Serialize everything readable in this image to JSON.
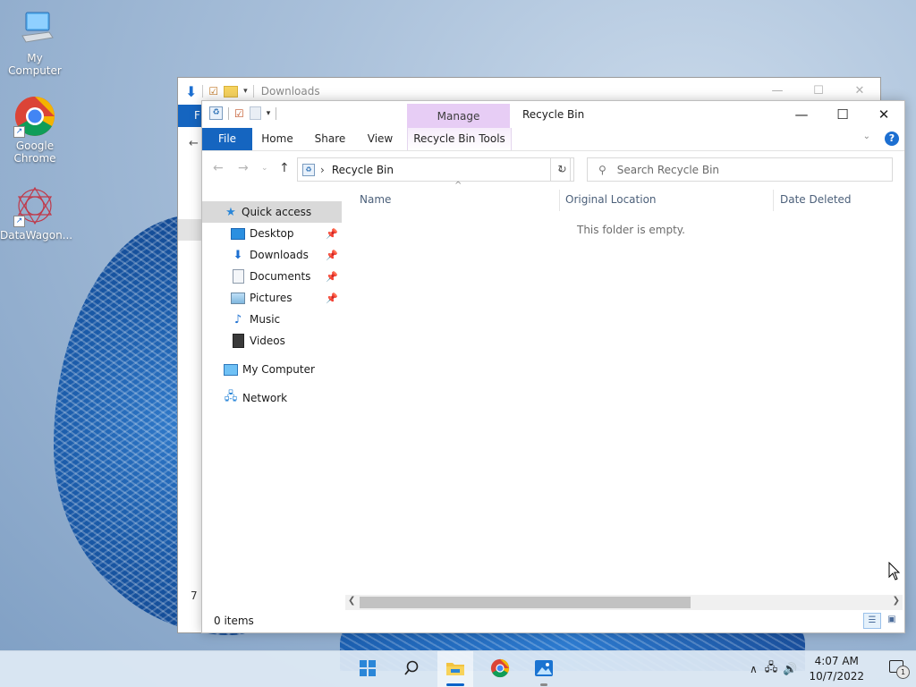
{
  "desktop": {
    "icons": [
      {
        "label": "My Computer"
      },
      {
        "label": "Google Chrome"
      },
      {
        "label": "DataWagon..."
      }
    ]
  },
  "back_window": {
    "title": "Downloads",
    "file_tab": "F",
    "status_count": "7 i"
  },
  "window": {
    "title": "Recycle Bin",
    "contextual_tab_group": "Manage",
    "ribbon": {
      "file": "File",
      "tabs": [
        "Home",
        "Share",
        "View"
      ],
      "contextual_tab": "Recycle Bin Tools"
    },
    "address": {
      "location": "Recycle Bin"
    },
    "search": {
      "placeholder": "Search Recycle Bin"
    },
    "nav_pane": {
      "quick_access": "Quick access",
      "pinned": [
        "Desktop",
        "Downloads",
        "Documents",
        "Pictures"
      ],
      "unpinned": [
        "Music",
        "Videos"
      ],
      "my_computer": "My Computer",
      "network": "Network"
    },
    "columns": [
      "Name",
      "Original Location",
      "Date Deleted"
    ],
    "empty_message": "This folder is empty.",
    "status": {
      "items": "0 items"
    }
  },
  "taskbar": {
    "time": "4:07 AM",
    "date": "10/7/2022",
    "notification_count": "1"
  },
  "colors": {
    "accent": "#1565c0",
    "manage_tab": "#e7cdf5"
  }
}
